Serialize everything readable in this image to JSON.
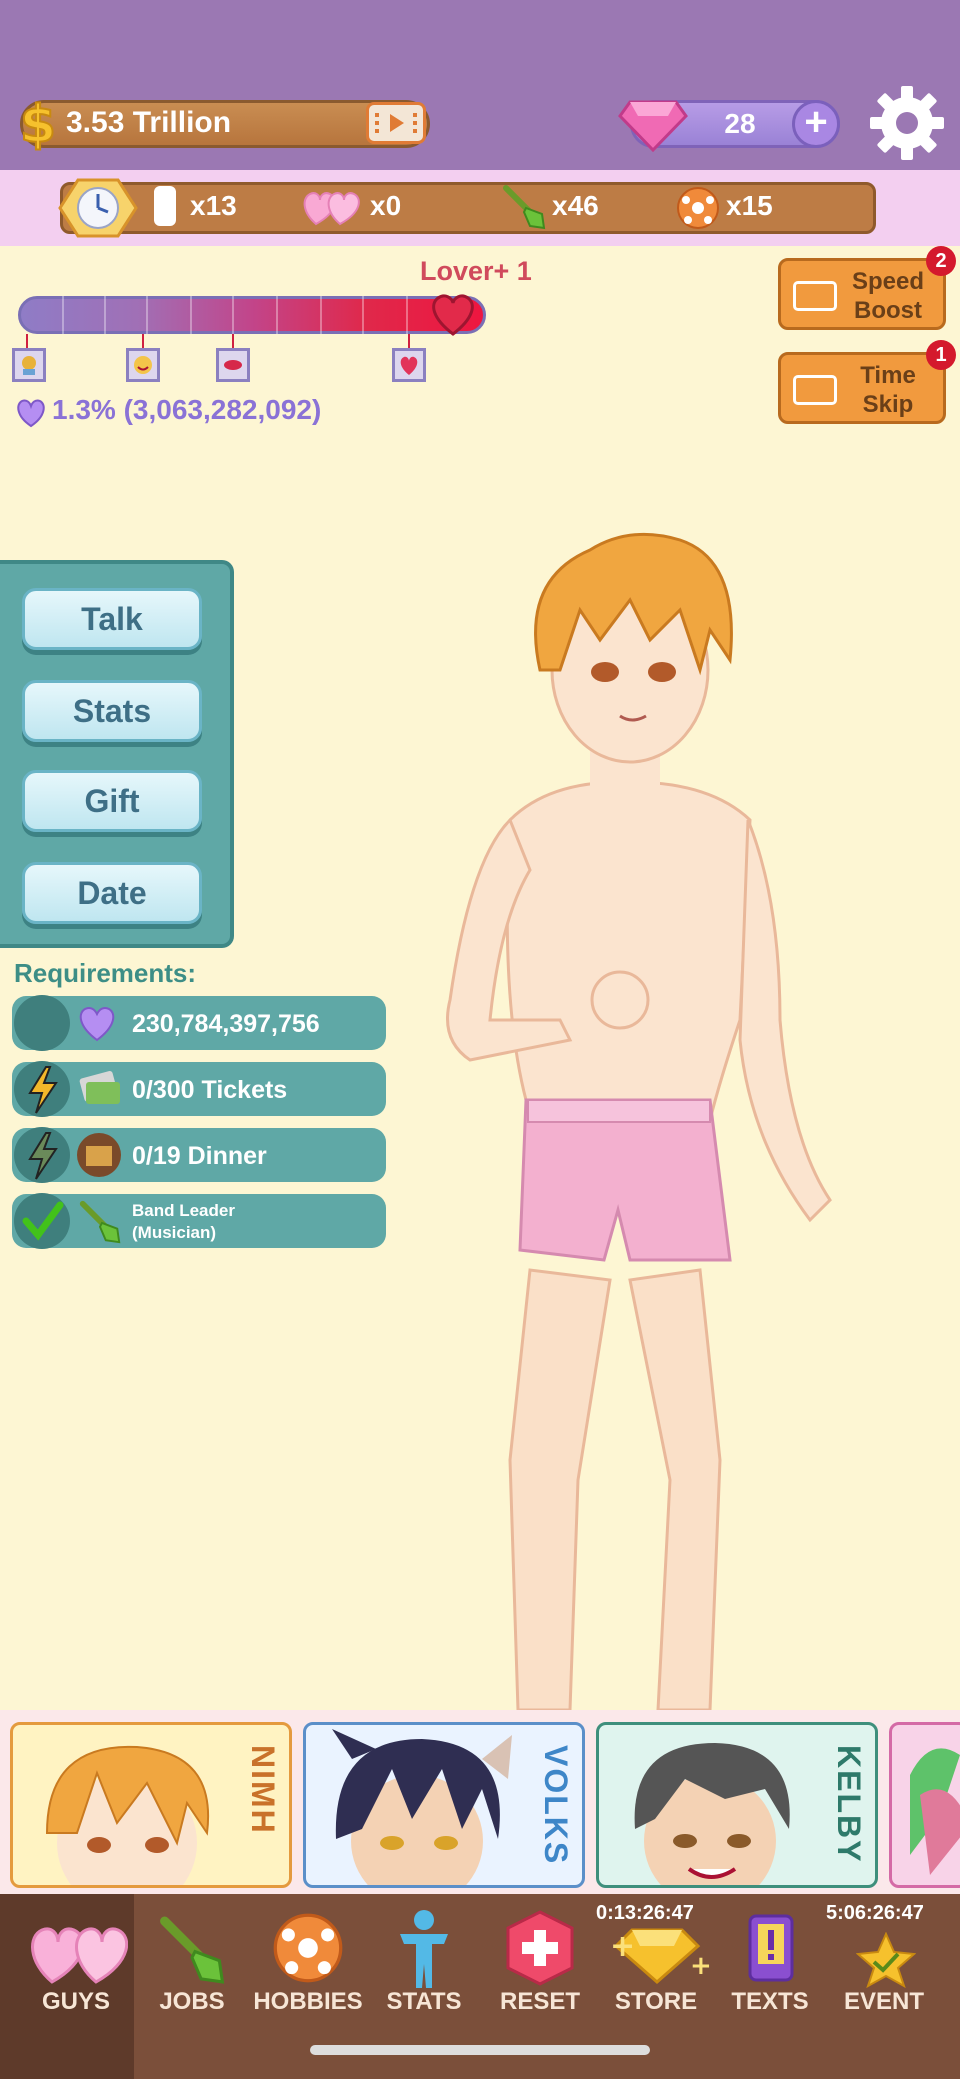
{
  "header": {
    "money": "3.53 Trillion",
    "gems": "28"
  },
  "resources": [
    {
      "name": "ticket",
      "count": "x13"
    },
    {
      "name": "hearts",
      "count": "x0"
    },
    {
      "name": "shovel",
      "count": "x46"
    },
    {
      "name": "ball",
      "count": "x15"
    }
  ],
  "progress": {
    "label": "Lover+ 1",
    "percent_text": "1.3% (3,063,282,092)",
    "fill": 0.9
  },
  "side_buttons": [
    {
      "label": "Speed Boost",
      "badge": "2"
    },
    {
      "label": "Time Skip",
      "badge": "1"
    }
  ],
  "actions": [
    "Talk",
    "Stats",
    "Gift",
    "Date"
  ],
  "requirements": {
    "label": "Requirements:",
    "items": [
      {
        "text": "230,784,397,756"
      },
      {
        "text": "0/300 Tickets"
      },
      {
        "text": "0/19 Dinner"
      },
      {
        "text": "Band Leader",
        "sub": "(Musician)"
      }
    ]
  },
  "guys": [
    {
      "name": "NIMH",
      "color": "#e8a04a"
    },
    {
      "name": "VOLKS",
      "color": "#3e86c8"
    },
    {
      "name": "KELBY",
      "color": "#2e7a6a"
    }
  ],
  "nav": {
    "items": [
      "GUYS",
      "JOBS",
      "HOBBIES",
      "STATS",
      "RESET",
      "STORE",
      "TEXTS",
      "EVENT"
    ],
    "store_timer": "0:13:26:47",
    "event_timer": "5:06:26:47"
  }
}
